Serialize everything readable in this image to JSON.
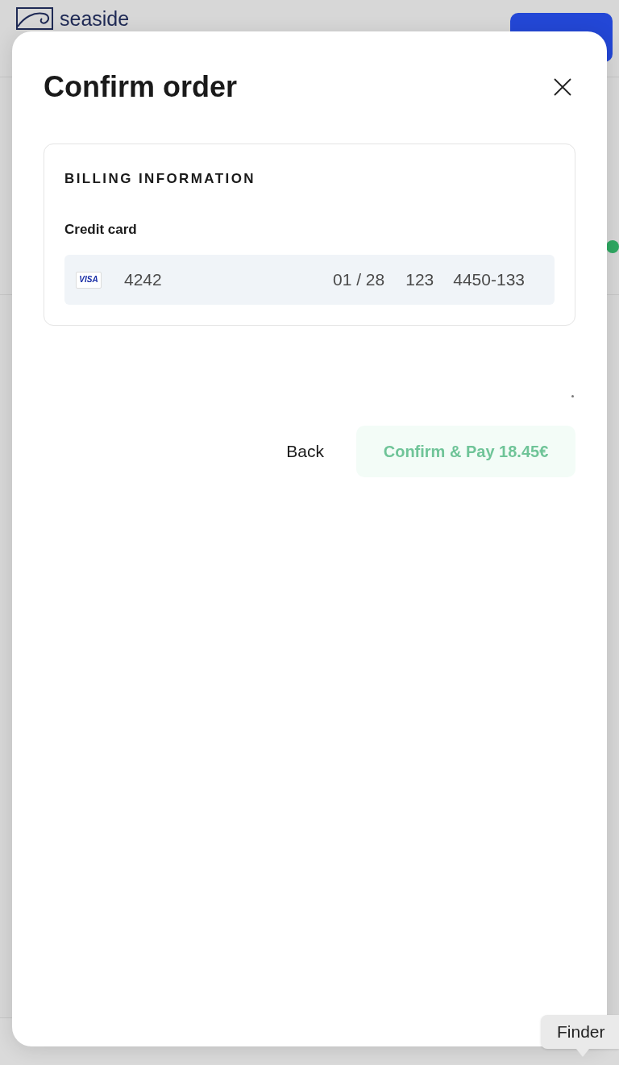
{
  "background_page": {
    "logo_text": "seaside"
  },
  "dialog": {
    "title": "Confirm order",
    "billing": {
      "heading": "BILLING INFORMATION",
      "label": "Credit card",
      "card": {
        "brand": "VISA",
        "number": "4242",
        "expiry": "01 / 28",
        "cvc": "123",
        "postal_code": "4450-133"
      }
    },
    "buttons": {
      "back": {
        "label": "Back"
      },
      "confirm": {
        "label": "Confirm & Pay 18.45€",
        "disabled": true
      }
    }
  },
  "tooltip": {
    "text": "Finder"
  }
}
